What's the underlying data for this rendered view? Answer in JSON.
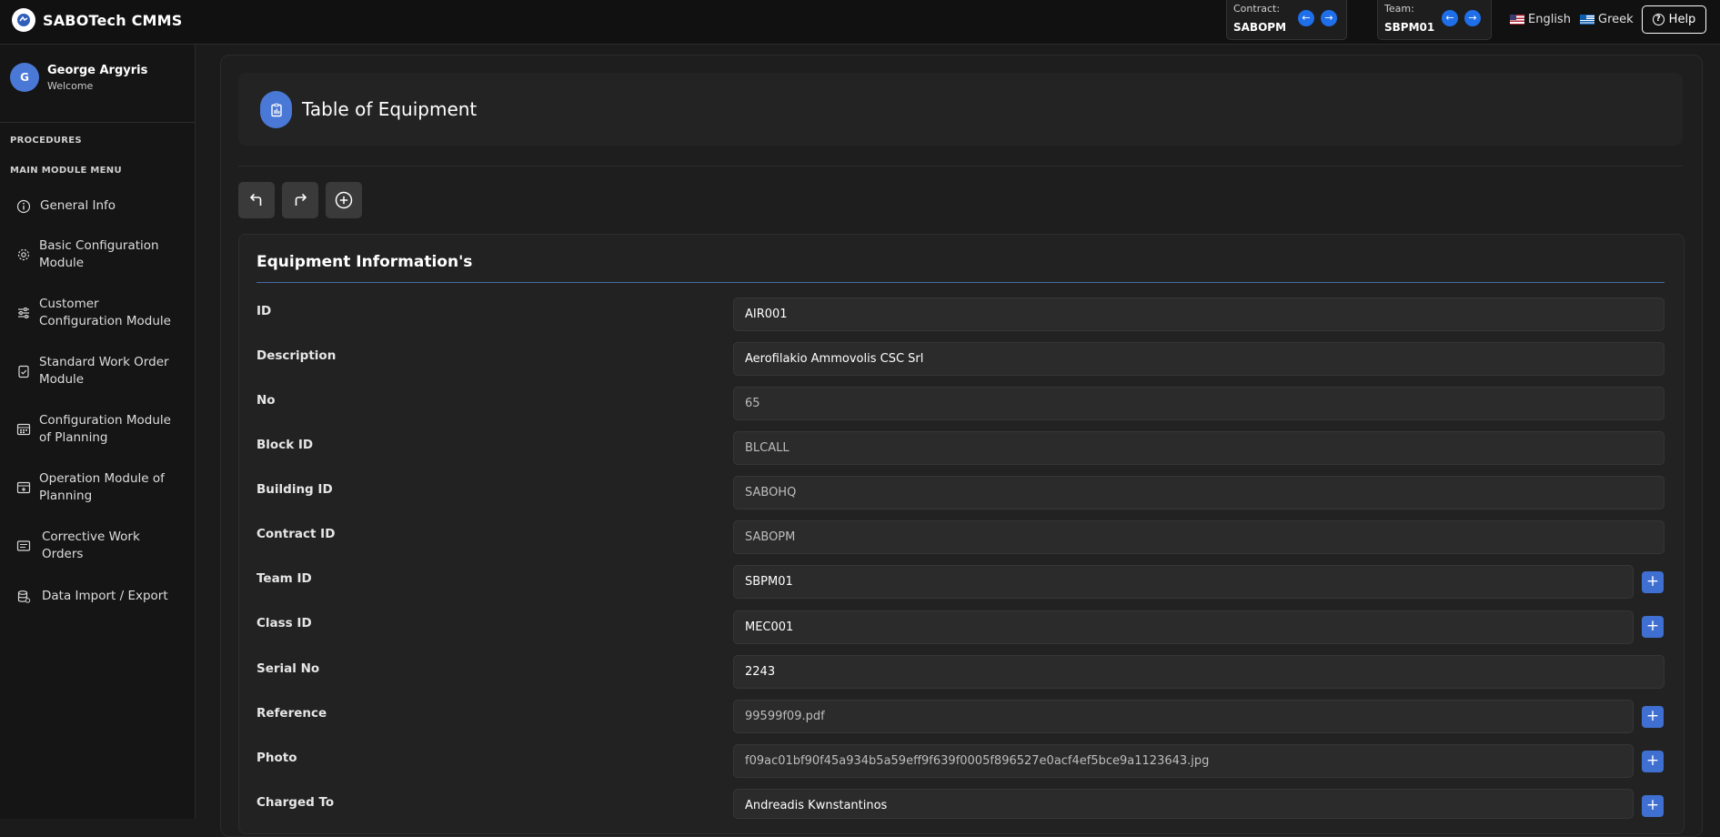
{
  "app": {
    "title": "SABOTech CMMS"
  },
  "header": {
    "contract": {
      "label": "Contract:",
      "value": "SABOPM"
    },
    "team": {
      "label": "Team:",
      "value": "SBPM01"
    },
    "languages": [
      {
        "label": "English",
        "flag": "us-flag-icon"
      },
      {
        "label": "Greek",
        "flag": "greece-flag-icon"
      }
    ],
    "help_label": "Help"
  },
  "sidebar": {
    "user": {
      "initial": "G",
      "name": "George Argyris",
      "subtitle": "Welcome"
    },
    "sections": {
      "procedures": "PROCEDURES",
      "main_menu": "MAIN MODULE MENU"
    },
    "items": [
      {
        "label": "General Info",
        "icon": "info-icon"
      },
      {
        "label": "Basic Configuration Module",
        "icon": "gear-icon"
      },
      {
        "label": "Customer Configuration Module",
        "icon": "sliders-icon"
      },
      {
        "label": "Standard Work Order Module",
        "icon": "clipboard-check-icon"
      },
      {
        "label": "Configuration Module of Planning",
        "icon": "calendar-grid-icon"
      },
      {
        "label": "Operation Module of Planning",
        "icon": "calendar-add-icon"
      },
      {
        "label": "Corrective Work Orders",
        "icon": "list-card-icon"
      },
      {
        "label": "Data Import / Export",
        "icon": "database-icon"
      }
    ]
  },
  "page": {
    "title": "Table of Equipment",
    "toolbar": {
      "undo": "undo-icon",
      "redo": "redo-icon",
      "add": "add-circle-icon"
    },
    "form": {
      "heading": "Equipment Information's",
      "fields": [
        {
          "label": "ID",
          "value": "AIR001"
        },
        {
          "label": "Description",
          "value": "Aerofilakio  Ammovolis CSC Srl"
        },
        {
          "label": "No",
          "value": "65"
        },
        {
          "label": "Block ID",
          "value": "BLCALL"
        },
        {
          "label": "Building ID",
          "value": "SABOHQ"
        },
        {
          "label": "Contract ID",
          "value": "SABOPM"
        },
        {
          "label": "Team ID",
          "value": "SBPM01"
        },
        {
          "label": "Class ID",
          "value": "MEC001"
        },
        {
          "label": "Serial No",
          "value": "2243"
        },
        {
          "label": "Reference",
          "value": "99599f09.pdf"
        },
        {
          "label": "Photo",
          "value": "f09ac01bf90f45a934b5a59eff9f639f0005f896527e0acf4ef5bce9a1123643.jpg"
        },
        {
          "label": "Charged To",
          "value": "Andreadis Kwnstantinos"
        }
      ],
      "plus_label": "+"
    }
  },
  "colors": {
    "accent": "#4a78d6",
    "nav_btn": "#1f6fea",
    "background": "#1b1b1b"
  }
}
